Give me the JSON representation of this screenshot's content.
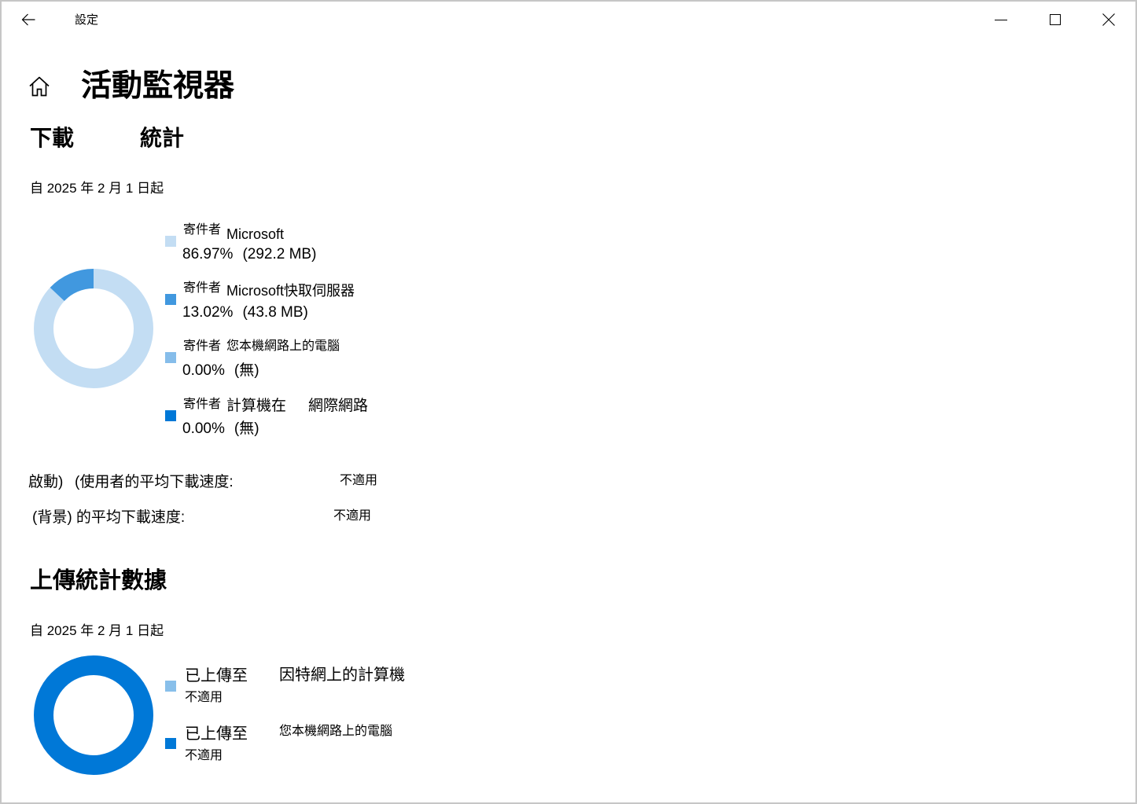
{
  "window": {
    "title": "設定",
    "back_icon": "arrow-left-icon",
    "minimize_icon": "minimize-icon",
    "maximize_icon": "maximize-icon",
    "close_icon": "close-icon"
  },
  "page": {
    "home_icon": "home-icon",
    "title": "活動監視器"
  },
  "download": {
    "heading_left": "下載",
    "heading_right": "統計",
    "since": "自 2025 年 2 月 1 日起",
    "legend": [
      {
        "prefix": "寄件者",
        "source": "Microsoft",
        "percent": "86.97%",
        "amount": "(292.2 MB)",
        "share": 86.97,
        "color": "#c3ddf3"
      },
      {
        "prefix": "寄件者",
        "source": "Microsoft快取伺服器",
        "percent": "13.02%",
        "amount": "(43.8 MB)",
        "share": 13.02,
        "color": "#4198df"
      },
      {
        "prefix": "寄件者",
        "source": "您本機網路上的電腦",
        "percent": "0.00%",
        "amount": "(無)",
        "share": 0,
        "color": "#86bdea"
      },
      {
        "prefix": "寄件者",
        "source": "計算機在",
        "source_suffix": "網際網路",
        "percent": "0.00%",
        "amount": "(無)",
        "share": 0,
        "color": "#0078d7"
      }
    ],
    "speeds": [
      {
        "label_parts": [
          "啟動)",
          "(使用者的平均下載速度:"
        ],
        "value": "不適用"
      },
      {
        "label_parts": [
          "(背景) 的平均下載速度:"
        ],
        "value": "不適用"
      }
    ]
  },
  "upload": {
    "heading": "上傳統計數據",
    "since": "自 2025 年 2 月 1 日起",
    "ring_color": "#0078d7",
    "legend": [
      {
        "prefix": "已上傳至",
        "target": "因特網上的計算機",
        "value": "不適用",
        "color": "#88bfea"
      },
      {
        "prefix": "已上傳至",
        "target": "您本機網路上的電腦",
        "value": "不適用",
        "color": "#0078d7"
      }
    ]
  }
}
